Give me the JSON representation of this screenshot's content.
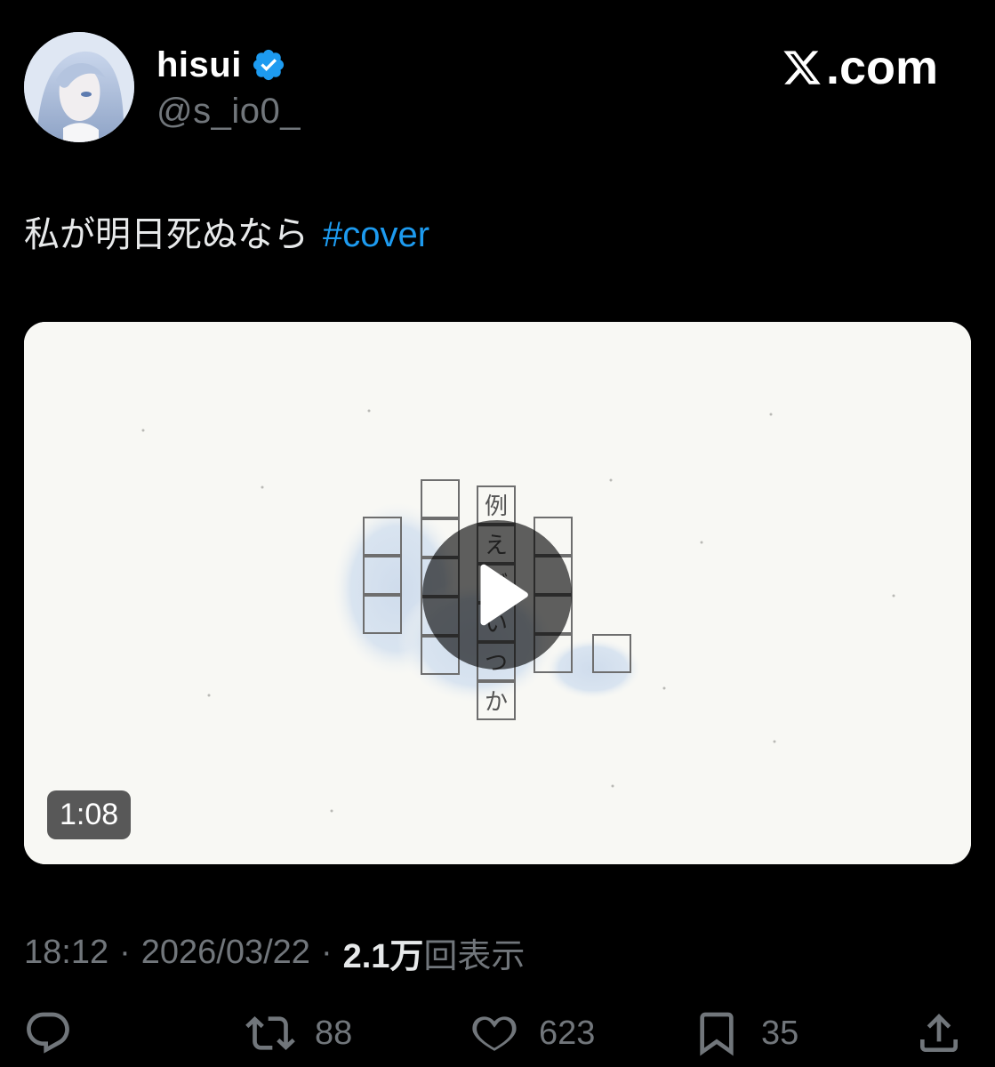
{
  "author": {
    "display_name": "hisui",
    "handle": "@s_io0_",
    "verified_icon": "verified-badge-icon",
    "avatar_icon": "avatar-image"
  },
  "site": {
    "logo_text": ".com",
    "logo_icon": "x-logo-icon"
  },
  "tweet": {
    "text": "私が明日死ぬなら",
    "hashtag": "#cover"
  },
  "media": {
    "type": "video",
    "duration": "1:08",
    "play_icon": "play-icon",
    "thumbnail_text": [
      "例",
      "え",
      "ば",
      "い",
      "つ",
      "か"
    ]
  },
  "meta": {
    "time": "18:12",
    "separator": "·",
    "date": "2026/03/22",
    "views_count": "2.1万",
    "views_label": "回表示"
  },
  "actions": {
    "reply": {
      "icon": "reply-icon",
      "count": ""
    },
    "retweet": {
      "icon": "retweet-icon",
      "count": "88"
    },
    "like": {
      "icon": "heart-icon",
      "count": "623"
    },
    "bookmark": {
      "icon": "bookmark-icon",
      "count": "35"
    },
    "share": {
      "icon": "share-icon",
      "count": ""
    }
  },
  "colors": {
    "background": "#000000",
    "text_primary": "#e7e9ea",
    "text_secondary": "#71767b",
    "accent": "#1d9bf0"
  }
}
